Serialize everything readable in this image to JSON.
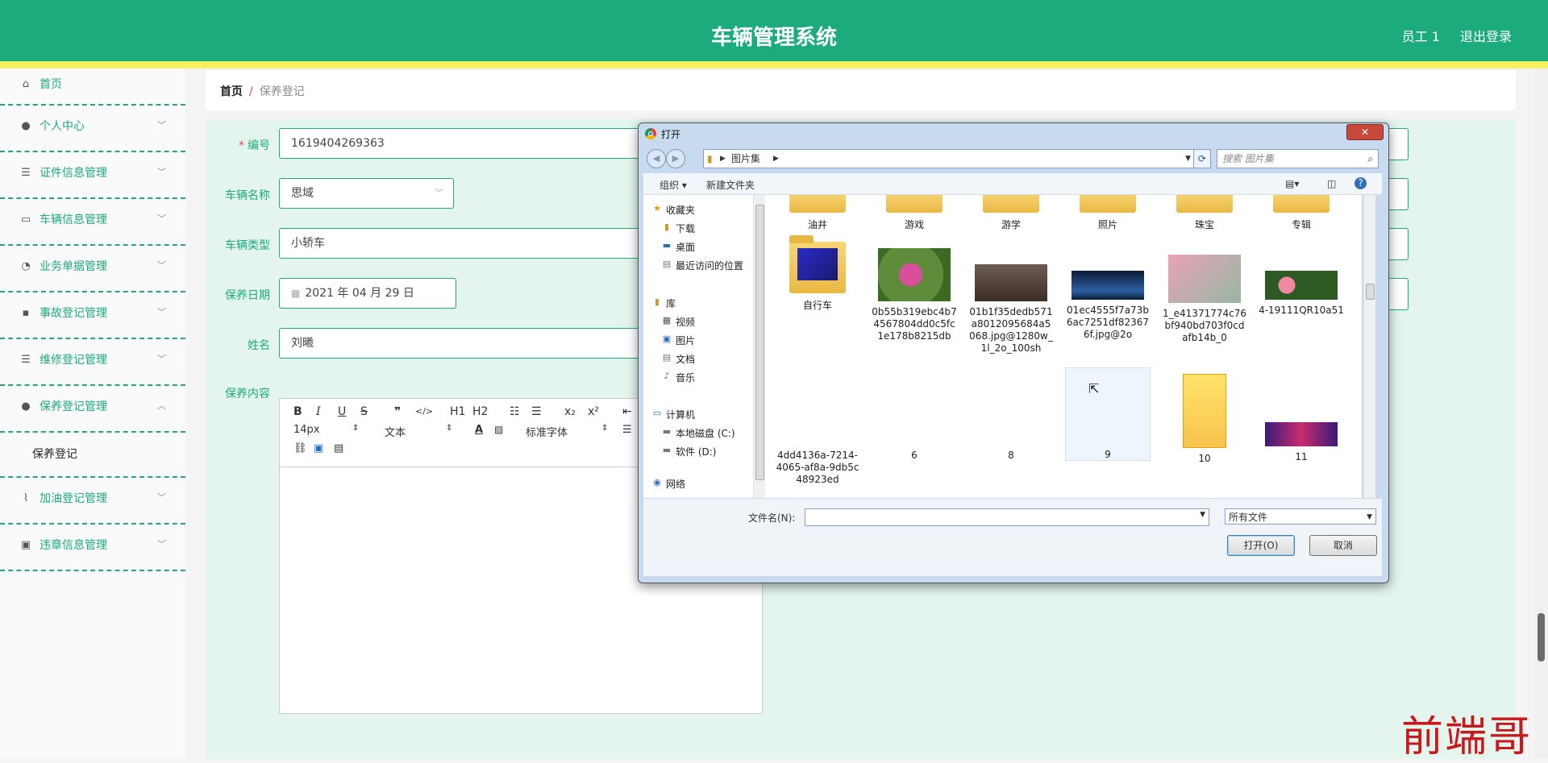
{
  "header": {
    "title": "车辆管理系统",
    "user": "员工 1",
    "logout": "退出登录"
  },
  "sidebar": {
    "items": [
      {
        "label": "首页",
        "icon": "home-icon"
      },
      {
        "label": "个人中心",
        "icon": "user-icon"
      },
      {
        "label": "证件信息管理",
        "icon": "list-icon"
      },
      {
        "label": "车辆信息管理",
        "icon": "comment-icon"
      },
      {
        "label": "业务单据管理",
        "icon": "gauge-icon"
      },
      {
        "label": "事故登记管理",
        "icon": "chat-icon"
      },
      {
        "label": "维修登记管理",
        "icon": "list-icon"
      },
      {
        "label": "保养登记管理",
        "icon": "user-icon"
      },
      {
        "label": "加油登记管理",
        "icon": "chart-icon"
      },
      {
        "label": "违章信息管理",
        "icon": "trash-icon"
      }
    ],
    "submenu": "保养登记"
  },
  "breadcrumb": {
    "home": "首页",
    "sep": "/",
    "current": "保养登记"
  },
  "form": {
    "required_mark": "*",
    "code_label": "编号",
    "code_value": "1619404269363",
    "vehicle_name_label": "车辆名称",
    "vehicle_name_value": "思域",
    "vehicle_type_label": "车辆类型",
    "vehicle_type_value": "小轿车",
    "date_label": "保养日期",
    "date_value": "2021 年 04 月 29 日",
    "name_label": "姓名",
    "name_value": "刘曦",
    "content_label": "保养内容"
  },
  "editor": {
    "bold": "B",
    "italic": "I",
    "underline": "U",
    "strike": "S",
    "quote": "❞",
    "code": "</>",
    "h1": "H1",
    "h2": "H2",
    "ol": "☷",
    "ul": "☰",
    "sub": "x₂",
    "sup": "x²",
    "font_size": "14px",
    "text_style": "文本",
    "font_family": "标准字体"
  },
  "dialog": {
    "title": "打开",
    "close": "✕",
    "path_root": "图片集",
    "search_placeholder": "搜索 图片集",
    "organize": "组织 ▾",
    "new_folder": "新建文件夹",
    "nav": {
      "favorites": "收藏夹",
      "downloads": "下载",
      "desktop": "桌面",
      "recent": "最近访问的位置",
      "library": "库",
      "videos": "视频",
      "pictures": "图片",
      "documents": "文档",
      "music": "音乐",
      "computer": "计算机",
      "disk_c": "本地磁盘 (C:)",
      "disk_d": "软件 (D:)",
      "network": "网络"
    },
    "files_row0": [
      "油井",
      "游戏",
      "游学",
      "照片",
      "珠宝",
      "专辑"
    ],
    "files_row1": [
      "自行车",
      "0b55b319ebc4b74567804dd0c5fc1e178b8215db",
      "01b1f35dedb571a8012095684a5068.jpg@1280w_1l_2o_100sh",
      "01ec4555f7a73b6ac7251df823676f.jpg@2o",
      "1_e41371774c76bf940bd703f0cdafb14b_0",
      "4-19111QR10a51"
    ],
    "files_row2": [
      "4dd4136a-7214-4065-af8a-9db5c48923ed",
      "6",
      "8",
      "9",
      "10",
      "11"
    ],
    "filename_label": "文件名(N):",
    "filetype": "所有文件",
    "open": "打开(O)",
    "cancel": "取消"
  },
  "watermark": "前端哥"
}
